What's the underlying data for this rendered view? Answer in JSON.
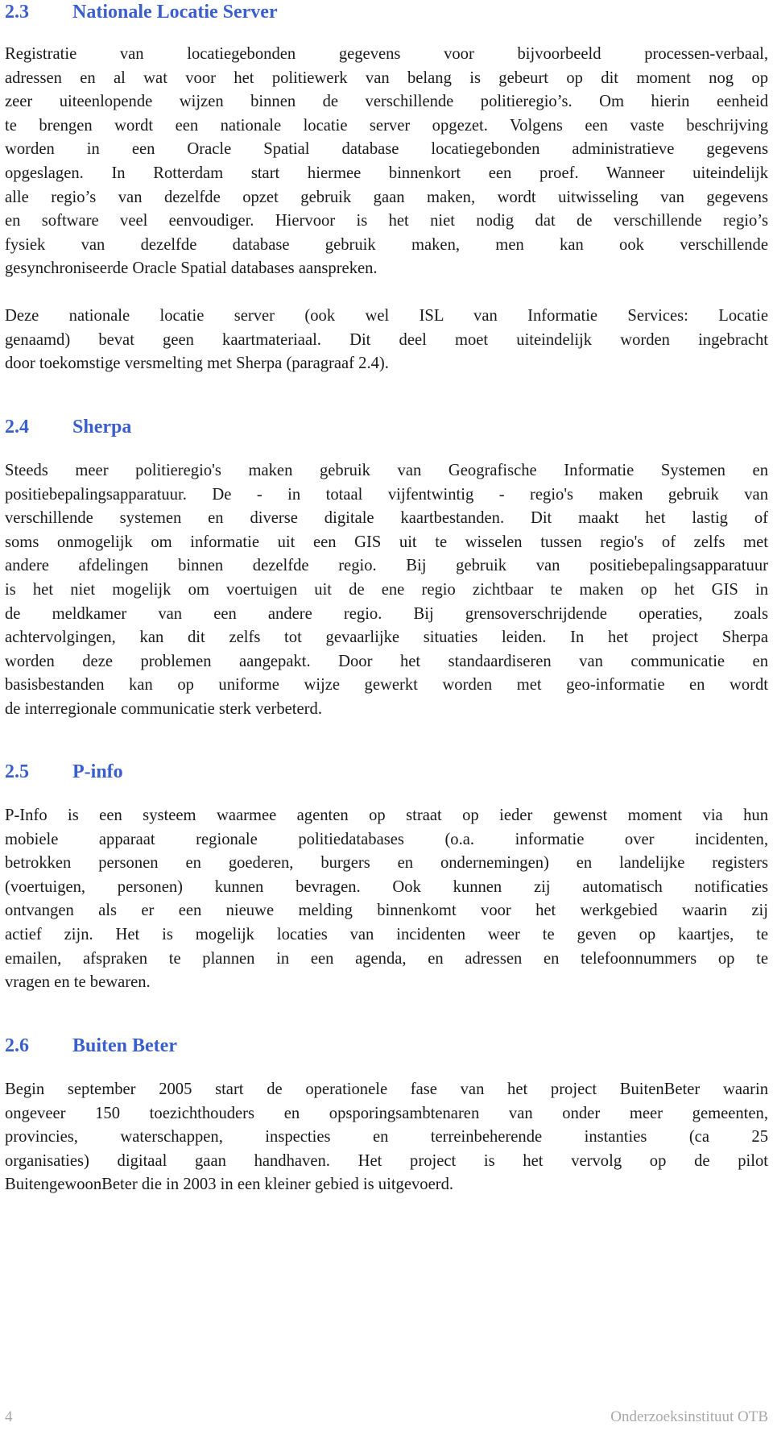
{
  "sections": [
    {
      "number": "2.3",
      "title": "Nationale Locatie Server",
      "paragraphs": [
        [
          "Registratie van locatiegebonden gegevens voor bijvoorbeeld processen-verbaal,",
          "adressen en al wat voor het politiewerk van belang is gebeurt op dit moment nog op",
          "zeer uiteenlopende wijzen binnen de verschillende politieregio’s. Om hierin eenheid",
          "te brengen wordt een nationale locatie server opgezet. Volgens een vaste beschrijving",
          "worden in een Oracle Spatial database locatiegebonden administratieve gegevens",
          "opgeslagen. In Rotterdam start hiermee binnenkort een proef. Wanneer uiteindelijk",
          "alle regio’s van dezelfde opzet gebruik gaan maken, wordt uitwisseling van gegevens",
          "en software veel eenvoudiger. Hiervoor is het niet nodig dat de verschillende regio’s",
          "fysiek van dezelfde database gebruik maken, men kan ook verschillende",
          "gesynchroniseerde Oracle Spatial databases aanspreken."
        ],
        [
          "Deze nationale locatie server (ook wel ISL van Informatie Services: Locatie",
          "genaamd) bevat geen kaartmateriaal. Dit deel moet uiteindelijk worden ingebracht",
          "door toekomstige versmelting met Sherpa (paragraaf 2.4)."
        ]
      ]
    },
    {
      "number": "2.4",
      "title": "Sherpa",
      "paragraphs": [
        [
          "Steeds meer politieregio's maken gebruik van Geografische Informatie Systemen en",
          "positiebepalingsapparatuur. De - in totaal vijfentwintig - regio's maken gebruik van",
          "verschillende systemen en diverse digitale kaartbestanden. Dit maakt het lastig of",
          "soms onmogelijk om informatie uit een GIS uit te wisselen tussen regio's of zelfs met",
          "andere afdelingen binnen dezelfde regio. Bij gebruik van positiebepalingsapparatuur",
          "is het niet mogelijk om voertuigen uit de ene regio zichtbaar te maken op het GIS in",
          "de meldkamer van een andere regio. Bij grensoverschrijdende operaties, zoals",
          "achtervolgingen, kan dit zelfs tot gevaarlijke situaties leiden. In het project Sherpa",
          "worden deze problemen aangepakt. Door het standaardiseren van communicatie en",
          "basisbestanden kan op uniforme wijze gewerkt worden met geo-informatie en wordt",
          "de interregionale communicatie sterk verbeterd."
        ]
      ]
    },
    {
      "number": "2.5",
      "title": "P-info",
      "paragraphs": [
        [
          "P-Info is een systeem waarmee agenten op straat op ieder gewenst moment via hun",
          "mobiele apparaat regionale politiedatabases (o.a. informatie over incidenten,",
          "betrokken personen en goederen, burgers en ondernemingen) en landelijke registers",
          "(voertuigen, personen) kunnen bevragen. Ook kunnen zij automatisch notificaties",
          "ontvangen als er een nieuwe melding binnenkomt voor het werkgebied waarin zij",
          "actief zijn. Het is mogelijk locaties van incidenten weer te geven op kaartjes, te",
          "emailen, afspraken te plannen in een agenda, en adressen en telefoonnummers op te",
          "vragen en te bewaren."
        ]
      ]
    },
    {
      "number": "2.6",
      "title": "Buiten Beter",
      "paragraphs": [
        [
          "Begin september 2005 start de operationele fase van het project BuitenBeter waarin",
          "ongeveer 150 toezichthouders en opsporingsambtenaren van onder meer gemeenten,",
          "provincies, waterschappen, inspecties en terreinbeherende instanties (ca 25",
          "organisaties) digitaal gaan handhaven. Het project is het vervolg op de pilot",
          "BuitengewoonBeter die in 2003 in een kleiner gebied is uitgevoerd."
        ]
      ]
    }
  ],
  "footer": {
    "page_number": "4",
    "institute": "Onderzoeksinstituut OTB"
  },
  "colors": {
    "heading": "#3a5fcd",
    "body_text": "#1a1a1a",
    "footer_text": "#a8a8a8"
  }
}
